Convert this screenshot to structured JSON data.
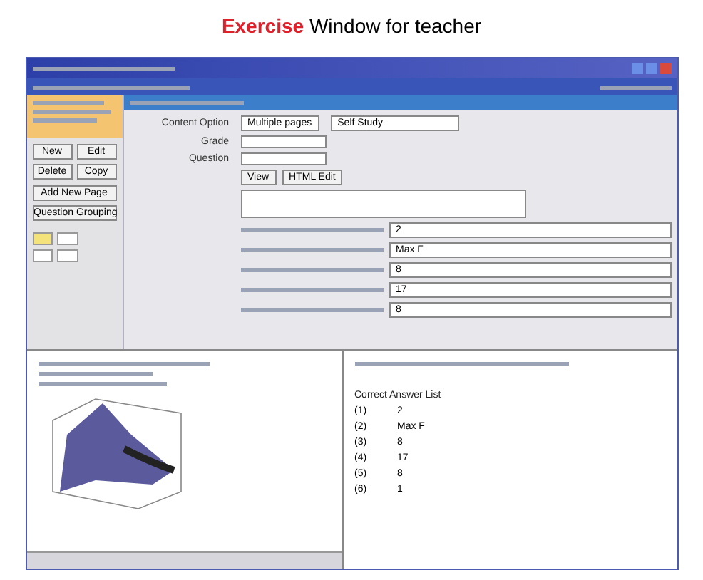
{
  "slide_title": {
    "highlight": "Exercise",
    "rest": "Window for teacher"
  },
  "left_panel": {
    "buttons": [
      "New",
      "Edit",
      "Delete",
      "Copy"
    ],
    "wide_buttons": [
      "Add New Page",
      "Question Grouping"
    ]
  },
  "form": {
    "rows": [
      {
        "label": "Content Option",
        "value": "Multiple pages",
        "extra": "Self Study"
      },
      {
        "label": "Grade",
        "value": "",
        "extra": ""
      },
      {
        "label": "Question",
        "value": "",
        "extra": ""
      }
    ],
    "action_buttons": [
      "View",
      "HTML Edit"
    ],
    "answer_fields": [
      "2",
      "Max F",
      "8",
      "17",
      "8"
    ]
  },
  "answer_panel": {
    "heading": "Correct Answer List",
    "answers": [
      {
        "number": "(1)",
        "value": "2"
      },
      {
        "number": "(2)",
        "value": "Max F"
      },
      {
        "number": "(3)",
        "value": "8"
      },
      {
        "number": "(4)",
        "value": "17"
      },
      {
        "number": "(5)",
        "value": "8"
      },
      {
        "number": "(6)",
        "value": "1"
      }
    ]
  }
}
